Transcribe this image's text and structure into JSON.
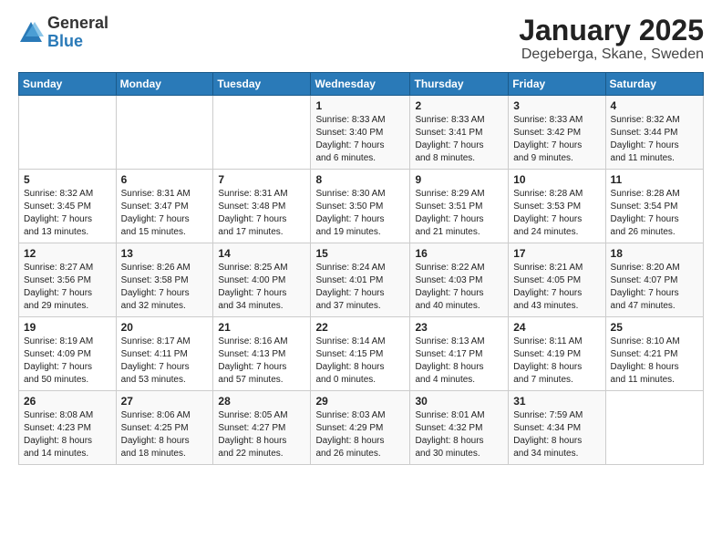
{
  "logo": {
    "general": "General",
    "blue": "Blue"
  },
  "title": "January 2025",
  "location": "Degeberga, Skane, Sweden",
  "weekdays": [
    "Sunday",
    "Monday",
    "Tuesday",
    "Wednesday",
    "Thursday",
    "Friday",
    "Saturday"
  ],
  "weeks": [
    [
      {
        "num": "",
        "info": ""
      },
      {
        "num": "",
        "info": ""
      },
      {
        "num": "",
        "info": ""
      },
      {
        "num": "1",
        "info": "Sunrise: 8:33 AM\nSunset: 3:40 PM\nDaylight: 7 hours\nand 6 minutes."
      },
      {
        "num": "2",
        "info": "Sunrise: 8:33 AM\nSunset: 3:41 PM\nDaylight: 7 hours\nand 8 minutes."
      },
      {
        "num": "3",
        "info": "Sunrise: 8:33 AM\nSunset: 3:42 PM\nDaylight: 7 hours\nand 9 minutes."
      },
      {
        "num": "4",
        "info": "Sunrise: 8:32 AM\nSunset: 3:44 PM\nDaylight: 7 hours\nand 11 minutes."
      }
    ],
    [
      {
        "num": "5",
        "info": "Sunrise: 8:32 AM\nSunset: 3:45 PM\nDaylight: 7 hours\nand 13 minutes."
      },
      {
        "num": "6",
        "info": "Sunrise: 8:31 AM\nSunset: 3:47 PM\nDaylight: 7 hours\nand 15 minutes."
      },
      {
        "num": "7",
        "info": "Sunrise: 8:31 AM\nSunset: 3:48 PM\nDaylight: 7 hours\nand 17 minutes."
      },
      {
        "num": "8",
        "info": "Sunrise: 8:30 AM\nSunset: 3:50 PM\nDaylight: 7 hours\nand 19 minutes."
      },
      {
        "num": "9",
        "info": "Sunrise: 8:29 AM\nSunset: 3:51 PM\nDaylight: 7 hours\nand 21 minutes."
      },
      {
        "num": "10",
        "info": "Sunrise: 8:28 AM\nSunset: 3:53 PM\nDaylight: 7 hours\nand 24 minutes."
      },
      {
        "num": "11",
        "info": "Sunrise: 8:28 AM\nSunset: 3:54 PM\nDaylight: 7 hours\nand 26 minutes."
      }
    ],
    [
      {
        "num": "12",
        "info": "Sunrise: 8:27 AM\nSunset: 3:56 PM\nDaylight: 7 hours\nand 29 minutes."
      },
      {
        "num": "13",
        "info": "Sunrise: 8:26 AM\nSunset: 3:58 PM\nDaylight: 7 hours\nand 32 minutes."
      },
      {
        "num": "14",
        "info": "Sunrise: 8:25 AM\nSunset: 4:00 PM\nDaylight: 7 hours\nand 34 minutes."
      },
      {
        "num": "15",
        "info": "Sunrise: 8:24 AM\nSunset: 4:01 PM\nDaylight: 7 hours\nand 37 minutes."
      },
      {
        "num": "16",
        "info": "Sunrise: 8:22 AM\nSunset: 4:03 PM\nDaylight: 7 hours\nand 40 minutes."
      },
      {
        "num": "17",
        "info": "Sunrise: 8:21 AM\nSunset: 4:05 PM\nDaylight: 7 hours\nand 43 minutes."
      },
      {
        "num": "18",
        "info": "Sunrise: 8:20 AM\nSunset: 4:07 PM\nDaylight: 7 hours\nand 47 minutes."
      }
    ],
    [
      {
        "num": "19",
        "info": "Sunrise: 8:19 AM\nSunset: 4:09 PM\nDaylight: 7 hours\nand 50 minutes."
      },
      {
        "num": "20",
        "info": "Sunrise: 8:17 AM\nSunset: 4:11 PM\nDaylight: 7 hours\nand 53 minutes."
      },
      {
        "num": "21",
        "info": "Sunrise: 8:16 AM\nSunset: 4:13 PM\nDaylight: 7 hours\nand 57 minutes."
      },
      {
        "num": "22",
        "info": "Sunrise: 8:14 AM\nSunset: 4:15 PM\nDaylight: 8 hours\nand 0 minutes."
      },
      {
        "num": "23",
        "info": "Sunrise: 8:13 AM\nSunset: 4:17 PM\nDaylight: 8 hours\nand 4 minutes."
      },
      {
        "num": "24",
        "info": "Sunrise: 8:11 AM\nSunset: 4:19 PM\nDaylight: 8 hours\nand 7 minutes."
      },
      {
        "num": "25",
        "info": "Sunrise: 8:10 AM\nSunset: 4:21 PM\nDaylight: 8 hours\nand 11 minutes."
      }
    ],
    [
      {
        "num": "26",
        "info": "Sunrise: 8:08 AM\nSunset: 4:23 PM\nDaylight: 8 hours\nand 14 minutes."
      },
      {
        "num": "27",
        "info": "Sunrise: 8:06 AM\nSunset: 4:25 PM\nDaylight: 8 hours\nand 18 minutes."
      },
      {
        "num": "28",
        "info": "Sunrise: 8:05 AM\nSunset: 4:27 PM\nDaylight: 8 hours\nand 22 minutes."
      },
      {
        "num": "29",
        "info": "Sunrise: 8:03 AM\nSunset: 4:29 PM\nDaylight: 8 hours\nand 26 minutes."
      },
      {
        "num": "30",
        "info": "Sunrise: 8:01 AM\nSunset: 4:32 PM\nDaylight: 8 hours\nand 30 minutes."
      },
      {
        "num": "31",
        "info": "Sunrise: 7:59 AM\nSunset: 4:34 PM\nDaylight: 8 hours\nand 34 minutes."
      },
      {
        "num": "",
        "info": ""
      }
    ]
  ]
}
